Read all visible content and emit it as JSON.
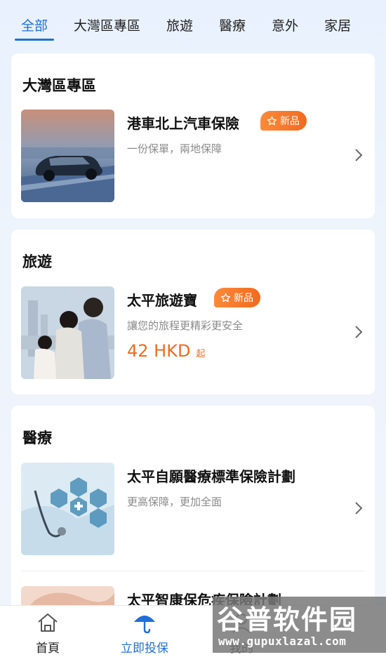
{
  "tabs": [
    {
      "label": "全部",
      "active": true
    },
    {
      "label": "大灣區專區",
      "active": false
    },
    {
      "label": "旅遊",
      "active": false
    },
    {
      "label": "醫療",
      "active": false
    },
    {
      "label": "意外",
      "active": false
    },
    {
      "label": "家居",
      "active": false
    }
  ],
  "sections": [
    {
      "title": "大灣區專區",
      "products": [
        {
          "name": "港車北上汽車保險",
          "badge": "新品",
          "desc": "一份保單，兩地保障"
        }
      ]
    },
    {
      "title": "旅遊",
      "products": [
        {
          "name": "太平旅遊寶",
          "badge": "新品",
          "desc": "讓您的旅程更精彩更安全",
          "price": "42 HKD",
          "price_suffix": "起"
        }
      ]
    },
    {
      "title": "醫療",
      "products": [
        {
          "name": "太平自願醫療標準保險計劃",
          "desc": "更高保障，更加全面"
        },
        {
          "name": "太平智康保危疾保險計劃"
        }
      ]
    }
  ],
  "bottom_nav": [
    {
      "label": "首頁",
      "icon": "home-icon",
      "active": false
    },
    {
      "label": "立即投保",
      "icon": "umbrella-icon",
      "active": true
    },
    {
      "label": "我的",
      "icon": "person-icon",
      "active": false
    }
  ],
  "watermark": {
    "title": "谷普软件园",
    "url": "www.gupuxlazal.com"
  },
  "colors": {
    "accent": "#1e6fd8",
    "badge": "#f26a1e",
    "price": "#f26a1e"
  }
}
